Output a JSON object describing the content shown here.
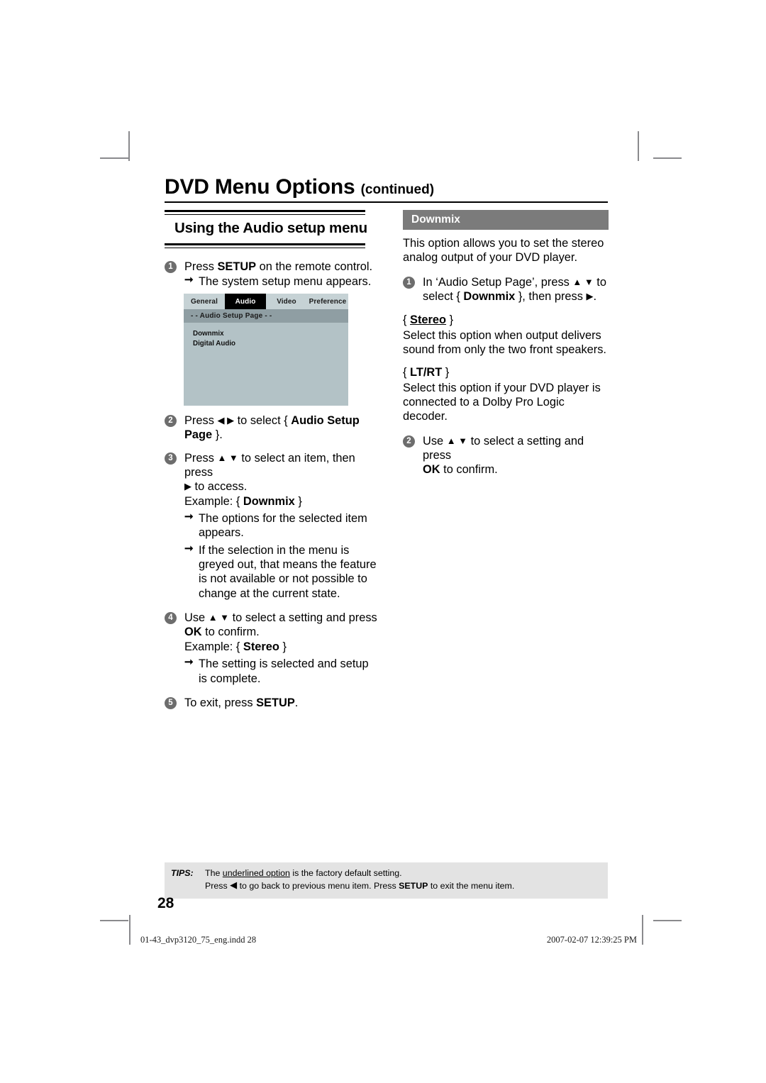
{
  "document": {
    "title": "DVD Menu Options",
    "title_suffix": "(continued)",
    "page_number": "28"
  },
  "left_column": {
    "section_heading": "Using the Audio setup menu",
    "steps": [
      {
        "num": "1",
        "text_parts": [
          "Press ",
          "SETUP",
          " on the remote control."
        ],
        "sub": [
          "The system setup menu appears."
        ]
      },
      {
        "num": "2",
        "text_parts": [
          "Press ",
          "◀ ▶",
          " to select { ",
          "Audio Setup Page",
          " }."
        ],
        "sub": []
      },
      {
        "num": "3",
        "text_parts": [
          "Press ",
          "▲ ▼",
          " to select an item, then press ",
          "▶",
          " to access."
        ],
        "example": "Example: { Downmix }",
        "sub": [
          "The options for the selected item appears.",
          "If the selection in the menu is greyed out, that means the feature is not available or not possible to change at the current state."
        ]
      },
      {
        "num": "4",
        "text_parts": [
          "Use ",
          "▲ ▼",
          " to select a setting and press ",
          "OK",
          " to confirm."
        ],
        "example": "Example: { Stereo }",
        "sub": [
          "The setting is selected and setup is complete."
        ]
      },
      {
        "num": "5",
        "text_parts": [
          "To exit, press ",
          "SETUP",
          "."
        ],
        "sub": []
      }
    ],
    "step1_line": "Press ",
    "step1_bold": "SETUP",
    "step1_tail": " on the remote control.",
    "step1_sub": "The system setup menu appears.",
    "step2_lead": "Press ",
    "step2_glyphs": "◀ ▶",
    "step2_mid": " to select { ",
    "step2_bold": "Audio Setup Page",
    "step2_tail": " }.",
    "step3_lead": "Press ",
    "step3_glyphs": "▲ ▼",
    "step3_mid": " to select an item, then press",
    "step3_glyph2": "▶",
    "step3_tail": " to access.",
    "step3_example_lead": "Example: { ",
    "step3_example_bold": "Downmix",
    "step3_example_tail": " }",
    "step3_sub1": "The options for the selected item appears.",
    "step3_sub2": "If the selection in the menu is greyed out, that means the feature is not available or not possible to change at the current state.",
    "step4_lead": "Use ",
    "step4_glyphs": "▲ ▼",
    "step4_mid": " to select a setting and press",
    "step4_bold": "OK",
    "step4_tail": " to confirm.",
    "step4_example_lead": "Example: { ",
    "step4_example_bold": "Stereo",
    "step4_example_tail": " }",
    "step4_sub1": "The setting is selected and setup is complete.",
    "step5_lead": "To exit, press ",
    "step5_bold": "SETUP",
    "step5_tail": "."
  },
  "tv_screen": {
    "tabs": [
      {
        "label": "General",
        "active": false
      },
      {
        "label": "Audio",
        "active": true
      },
      {
        "label": "Video",
        "active": false
      },
      {
        "label": "Preference",
        "active": false
      }
    ],
    "tab_general": "General",
    "tab_audio": "Audio",
    "tab_video": "Video",
    "tab_preference": "Preference",
    "subbar": "- -   Audio Setup Page   - -",
    "items": [
      "Downmix",
      "Digital Audio"
    ],
    "item_downmix": "Downmix",
    "item_digital_audio": "Digital Audio",
    "colors": {
      "screen_bg": "#b3c2c6",
      "tab_bg": "#c6d2d5",
      "tab_active_bg": "#000000",
      "subbar_bg": "#8f9ea3"
    }
  },
  "right_column": {
    "section_title": "Downmix",
    "intro": "This option allows you to set the stereo analog output of your DVD player.",
    "step1_lead": "In ‘Audio Setup Page’, press ",
    "step1_glyphs": "▲ ▼",
    "step1_mid": " to select { ",
    "step1_bold": "Downmix",
    "step1_tail": " }, then press ",
    "step1_glyph2": "▶",
    "step1_end": ".",
    "option_stereo_open": "{ ",
    "option_stereo": "Stereo",
    "option_stereo_close": " }",
    "option_stereo_desc": "Select this option when output delivers sound from only the two front speakers.",
    "option_ltrt_open": "{ ",
    "option_ltrt": "LT/RT",
    "option_ltrt_close": " }",
    "option_ltrt_desc": "Select this option if your DVD player is connected to a Dolby Pro Logic decoder.",
    "step2_lead": "Use ",
    "step2_glyphs": "▲ ▼",
    "step2_mid": " to select a setting and press",
    "step2_bold": "OK",
    "step2_tail": " to confirm.",
    "num1": "1",
    "num2": "2",
    "accent_bar_color": "#7b7b7b"
  },
  "tips": {
    "label": "TIPS:",
    "line1_pre": "The ",
    "line1_underline": "underlined option",
    "line1_post": " is the factory default setting.",
    "line2_pre": "Press ",
    "line2_glyph": "◀",
    "line2_mid": " to go back to previous menu item. Press ",
    "line2_bold": "SETUP",
    "line2_post": " to exit the menu item."
  },
  "footer": {
    "filename": "01-43_dvp3120_75_eng.indd   28",
    "timestamp": "2007-02-07   12:39:25 PM"
  }
}
